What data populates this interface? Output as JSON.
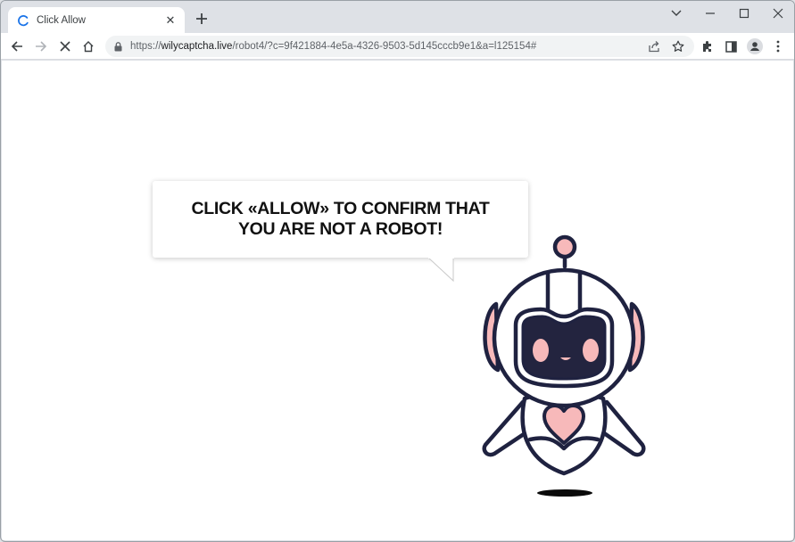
{
  "browser": {
    "tab": {
      "title": "Click Allow",
      "favicon": "loading-spinner-icon",
      "close_icon": "close-icon"
    },
    "new_tab_icon": "plus-icon",
    "window_controls": [
      "chevron-down-icon",
      "minimize-icon",
      "maximize-icon",
      "close-icon"
    ],
    "nav": [
      "back-icon",
      "forward-icon",
      "stop-icon",
      "home-icon"
    ],
    "omnibox": {
      "lock_icon": "lock-icon",
      "url_scheme": "https://",
      "url_host": "wilycaptcha.live",
      "url_path": "/robot4/?c=9f421884-4e5a-4326-9503-5d145cccb9e1&a=l125154#"
    },
    "toolbar_icons": [
      "share-icon",
      "bookmark-star-icon",
      "extensions-icon",
      "side-panel-icon",
      "profile-icon",
      "menu-kebab-icon"
    ]
  },
  "page": {
    "message": "CLICK «ALLOW» TO CONFIRM THAT YOU ARE NOT A ROBOT!",
    "colors": {
      "robot_outline": "#1f2240",
      "robot_accent": "#f7b9ba",
      "visor": "#23243f"
    }
  }
}
